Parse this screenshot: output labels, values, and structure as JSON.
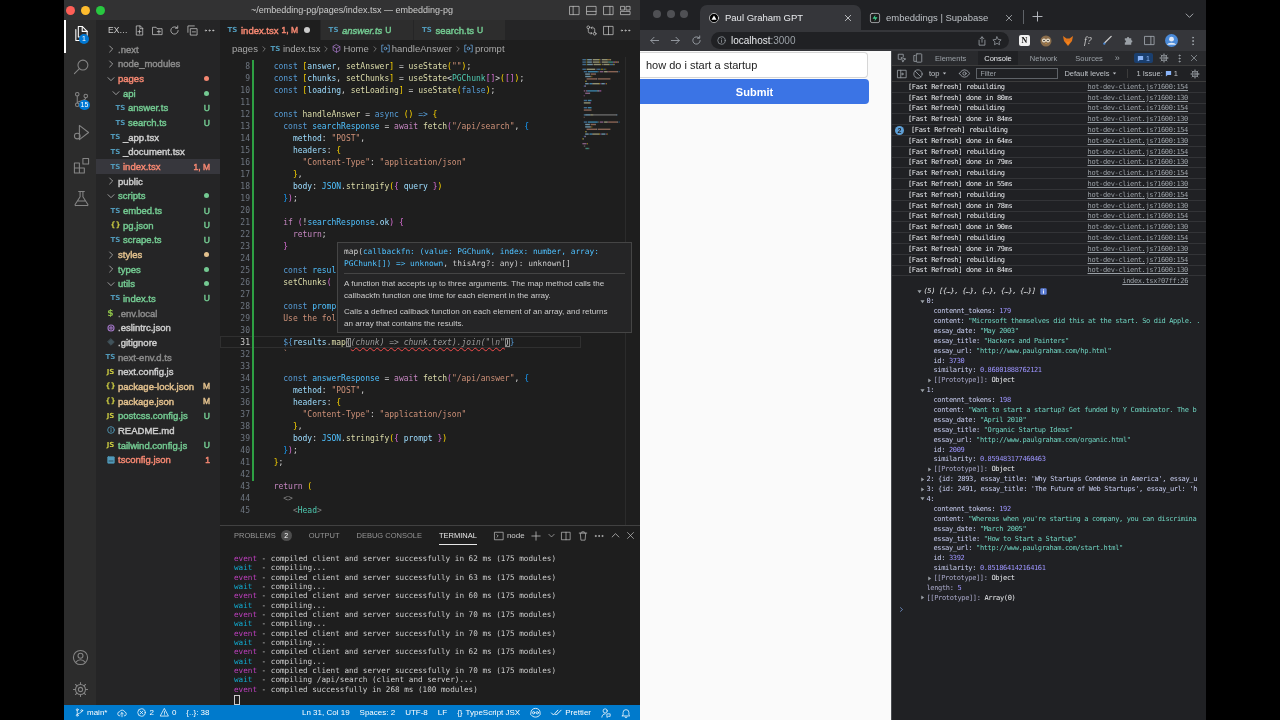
{
  "vscode": {
    "title": "~/embedding-pg/pages/index.tsx — embedding-pg",
    "focused": true,
    "activity_bar": [
      {
        "kind": "explorer",
        "badge": "1",
        "selected": true
      },
      {
        "kind": "search",
        "selected": false
      },
      {
        "kind": "source-control",
        "badge": "15",
        "selected": false
      },
      {
        "kind": "run",
        "selected": false
      },
      {
        "kind": "extensions",
        "selected": false
      },
      {
        "kind": "testing",
        "selected": false
      }
    ],
    "activity_bar_bottom": [
      {
        "kind": "account"
      },
      {
        "kind": "settings"
      }
    ],
    "explorer": {
      "title": "EX…",
      "tree": [
        {
          "name": ".next",
          "kind": "folder",
          "expanded": false,
          "changed": false,
          "color": "#8b8b8b",
          "selected": false
        },
        {
          "name": "node_modules",
          "kind": "folder",
          "expanded": false,
          "changed": false,
          "color": "#8b8b8b",
          "selected": false
        },
        {
          "name": "pages",
          "kind": "folder",
          "expanded": true,
          "changed": true,
          "color": "#f48771",
          "selected": false,
          "children": [
            {
              "name": "api",
              "kind": "folder",
              "expanded": true,
              "changed": true,
              "color": "#73c991",
              "selected": false,
              "children": [
                {
                  "name": "answer.ts",
                  "kind": "ts",
                  "glyph": "TS",
                  "color": "#73c991",
                  "badge": "U",
                  "selected": false
                },
                {
                  "name": "search.ts",
                  "kind": "ts",
                  "glyph": "TS",
                  "color": "#73c991",
                  "badge": "U",
                  "selected": false
                }
              ]
            },
            {
              "name": "_app.tsx",
              "kind": "ts",
              "glyph": "TS",
              "color": "#cccccc",
              "selected": false
            },
            {
              "name": "_document.tsx",
              "kind": "ts",
              "glyph": "TS",
              "color": "#cccccc",
              "selected": false
            },
            {
              "name": "index.tsx",
              "kind": "ts",
              "glyph": "TS",
              "color": "#f48771",
              "badge": "1, M",
              "selected": true
            }
          ]
        },
        {
          "name": "public",
          "kind": "folder",
          "expanded": false,
          "changed": false,
          "color": "#cccccc",
          "selected": false
        },
        {
          "name": "scripts",
          "kind": "folder",
          "expanded": true,
          "changed": true,
          "color": "#73c991",
          "selected": false,
          "children": [
            {
              "name": "embed.ts",
              "kind": "ts",
              "glyph": "TS",
              "color": "#73c991",
              "badge": "U",
              "selected": false
            },
            {
              "name": "pg.json",
              "kind": "json",
              "glyph": "{}",
              "color": "#73c991",
              "badge": "U",
              "selected": false
            },
            {
              "name": "scrape.ts",
              "kind": "ts",
              "glyph": "TS",
              "color": "#73c991",
              "badge": "U",
              "selected": false
            }
          ]
        },
        {
          "name": "styles",
          "kind": "folder",
          "expanded": false,
          "changed": true,
          "color": "#e2c08d",
          "selected": false
        },
        {
          "name": "types",
          "kind": "folder",
          "expanded": false,
          "changed": true,
          "color": "#73c991",
          "selected": false
        },
        {
          "name": "utils",
          "kind": "folder",
          "expanded": true,
          "changed": true,
          "color": "#73c991",
          "selected": false,
          "children": [
            {
              "name": "index.ts",
              "kind": "ts",
              "glyph": "TS",
              "color": "#73c991",
              "badge": "U",
              "selected": false
            }
          ]
        },
        {
          "name": ".env.local",
          "kind": "env",
          "glyph": "$",
          "color": "#8b8b8b",
          "selected": false
        },
        {
          "name": ".eslintrc.json",
          "kind": "eslint",
          "color": "#cccccc",
          "selected": false
        },
        {
          "name": ".gitignore",
          "kind": "git",
          "color": "#cccccc",
          "selected": false
        },
        {
          "name": "next-env.d.ts",
          "kind": "ts",
          "glyph": "TS",
          "color": "#8b8b8b",
          "selected": false
        },
        {
          "name": "next.config.js",
          "kind": "js",
          "glyph": "JS",
          "color": "#cccccc",
          "selected": false
        },
        {
          "name": "package-lock.json",
          "kind": "json",
          "glyph": "{}",
          "color": "#e2c08d",
          "badge": "M",
          "selected": false
        },
        {
          "name": "package.json",
          "kind": "json",
          "glyph": "{}",
          "color": "#e2c08d",
          "badge": "M",
          "selected": false
        },
        {
          "name": "postcss.config.js",
          "kind": "js",
          "glyph": "JS",
          "color": "#73c991",
          "badge": "U",
          "selected": false
        },
        {
          "name": "README.md",
          "kind": "info",
          "color": "#cccccc",
          "selected": false
        },
        {
          "name": "tailwind.config.js",
          "kind": "js",
          "glyph": "JS",
          "color": "#73c991",
          "badge": "U",
          "selected": false
        },
        {
          "name": "tsconfig.json",
          "kind": "tsconfig",
          "color": "#f48771",
          "badge": "1",
          "selected": false
        }
      ]
    },
    "editor": {
      "tabs": [
        {
          "glyph": "TS",
          "label": "index.tsx",
          "badge": "1, M",
          "color": "#f48771",
          "selected": true,
          "preview": false,
          "dirty": true
        },
        {
          "glyph": "TS",
          "label": "answer.ts",
          "badge": "U",
          "color": "#73c991",
          "selected": false,
          "preview": true,
          "dirty": false
        },
        {
          "glyph": "TS",
          "label": "search.ts",
          "badge": "U",
          "color": "#73c991",
          "selected": false,
          "preview": false,
          "dirty": false
        }
      ],
      "breadcrumbs": [
        {
          "kind": "folder",
          "label": "pages"
        },
        {
          "kind": "file",
          "glyph": "TS",
          "label": "index.tsx"
        },
        {
          "kind": "component",
          "label": "Home"
        },
        {
          "kind": "variable",
          "label": "handleAnswer"
        },
        {
          "kind": "variable",
          "label": "prompt"
        }
      ],
      "lines": [
        {
          "number": "8",
          "modified": true,
          "current": false,
          "tokens": [
            {
              "kind": "kw",
              "text": "  const "
            },
            {
              "kind": "b1",
              "text": "["
            },
            {
              "kind": "var",
              "text": "answer"
            },
            {
              "kind": "p",
              "text": ", "
            },
            {
              "kind": "fn",
              "text": "setAnswer"
            },
            {
              "kind": "b1",
              "text": "]"
            },
            {
              "kind": "p",
              "text": " = "
            },
            {
              "kind": "fn",
              "text": "useState"
            },
            {
              "kind": "b1",
              "text": "("
            },
            {
              "kind": "str",
              "text": "\"\""
            },
            {
              "kind": "b1",
              "text": ")"
            },
            {
              "kind": "p",
              "text": ";"
            }
          ]
        },
        {
          "number": "9",
          "modified": true,
          "current": false,
          "tokens": [
            {
              "kind": "kw",
              "text": "  const "
            },
            {
              "kind": "b1",
              "text": "["
            },
            {
              "kind": "var",
              "text": "chunks"
            },
            {
              "kind": "p",
              "text": ", "
            },
            {
              "kind": "fn",
              "text": "setChunks"
            },
            {
              "kind": "b1",
              "text": "]"
            },
            {
              "kind": "p",
              "text": " = "
            },
            {
              "kind": "fn",
              "text": "useState"
            },
            {
              "kind": "p",
              "text": "<"
            },
            {
              "kind": "type",
              "text": "PGChunk"
            },
            {
              "kind": "b2",
              "text": "[]"
            },
            {
              "kind": "p",
              "text": ">"
            },
            {
              "kind": "b1",
              "text": "("
            },
            {
              "kind": "b2",
              "text": "[]"
            },
            {
              "kind": "b1",
              "text": ")"
            },
            {
              "kind": "p",
              "text": ";"
            }
          ]
        },
        {
          "number": "10",
          "modified": true,
          "current": false,
          "tokens": [
            {
              "kind": "kw",
              "text": "  const "
            },
            {
              "kind": "b1",
              "text": "["
            },
            {
              "kind": "var",
              "text": "loading"
            },
            {
              "kind": "p",
              "text": ", "
            },
            {
              "kind": "fn",
              "text": "setLoading"
            },
            {
              "kind": "b1",
              "text": "]"
            },
            {
              "kind": "p",
              "text": " = "
            },
            {
              "kind": "fn",
              "text": "useState"
            },
            {
              "kind": "b1",
              "text": "("
            },
            {
              "kind": "kw",
              "text": "false"
            },
            {
              "kind": "b1",
              "text": ")"
            },
            {
              "kind": "p",
              "text": ";"
            }
          ]
        },
        {
          "number": "11",
          "modified": true,
          "current": false
        },
        {
          "number": "12",
          "modified": true,
          "current": false,
          "tokens": [
            {
              "kind": "kw",
              "text": "  const "
            },
            {
              "kind": "fn",
              "text": "handleAnswer"
            },
            {
              "kind": "p",
              "text": " = "
            },
            {
              "kind": "kw",
              "text": "async "
            },
            {
              "kind": "b1",
              "text": "() "
            },
            {
              "kind": "kw",
              "text": "=> "
            },
            {
              "kind": "b1",
              "text": "{"
            }
          ]
        },
        {
          "number": "13",
          "modified": true,
          "current": false,
          "tokens": [
            {
              "kind": "kw",
              "text": "    const "
            },
            {
              "kind": "cst",
              "text": "searchResponse"
            },
            {
              "kind": "p",
              "text": " = "
            },
            {
              "kind": "ctl",
              "text": "await "
            },
            {
              "kind": "fn",
              "text": "fetch"
            },
            {
              "kind": "b2",
              "text": "("
            },
            {
              "kind": "str",
              "text": "\"/api/search\""
            },
            {
              "kind": "p",
              "text": ", "
            },
            {
              "kind": "b3",
              "text": "{"
            }
          ]
        },
        {
          "number": "14",
          "modified": true,
          "current": false,
          "tokens": [
            {
              "kind": "var",
              "text": "      method"
            },
            {
              "kind": "p",
              "text": ": "
            },
            {
              "kind": "str",
              "text": "\"POST\""
            },
            {
              "kind": "p",
              "text": ","
            }
          ]
        },
        {
          "number": "15",
          "modified": true,
          "current": false,
          "tokens": [
            {
              "kind": "var",
              "text": "      headers"
            },
            {
              "kind": "p",
              "text": ": "
            },
            {
              "kind": "b1",
              "text": "{"
            }
          ]
        },
        {
          "number": "16",
          "modified": true,
          "current": false,
          "tokens": [
            {
              "kind": "str",
              "text": "        \"Content-Type\""
            },
            {
              "kind": "p",
              "text": ": "
            },
            {
              "kind": "str",
              "text": "\"application/json\""
            }
          ]
        },
        {
          "number": "17",
          "modified": true,
          "current": false,
          "tokens": [
            {
              "kind": "b1",
              "text": "      }"
            },
            {
              "kind": "p",
              "text": ","
            }
          ]
        },
        {
          "number": "18",
          "modified": true,
          "current": false,
          "tokens": [
            {
              "kind": "var",
              "text": "      body"
            },
            {
              "kind": "p",
              "text": ": "
            },
            {
              "kind": "cst",
              "text": "JSON"
            },
            {
              "kind": "p",
              "text": "."
            },
            {
              "kind": "fn",
              "text": "stringify"
            },
            {
              "kind": "b1",
              "text": "("
            },
            {
              "kind": "b2",
              "text": "{"
            },
            {
              "kind": "var",
              "text": " query "
            },
            {
              "kind": "b2",
              "text": "}"
            },
            {
              "kind": "b1",
              "text": ")"
            }
          ]
        },
        {
          "number": "19",
          "modified": true,
          "current": false,
          "tokens": [
            {
              "kind": "b3",
              "text": "    }"
            },
            {
              "kind": "b2",
              "text": ")"
            },
            {
              "kind": "p",
              "text": ";"
            }
          ]
        },
        {
          "number": "20",
          "modified": true,
          "current": false
        },
        {
          "number": "21",
          "modified": true,
          "current": false,
          "tokens": [
            {
              "kind": "ctl",
              "text": "    if "
            },
            {
              "kind": "b2",
              "text": "("
            },
            {
              "kind": "p",
              "text": "!"
            },
            {
              "kind": "cst",
              "text": "searchResponse"
            },
            {
              "kind": "p",
              "text": "."
            },
            {
              "kind": "var",
              "text": "ok"
            },
            {
              "kind": "b2",
              "text": ") {"
            }
          ]
        },
        {
          "number": "22",
          "modified": true,
          "current": false,
          "tokens": [
            {
              "kind": "ctl",
              "text": "      return"
            },
            {
              "kind": "p",
              "text": ";"
            }
          ]
        },
        {
          "number": "23",
          "modified": true,
          "current": false,
          "tokens": [
            {
              "kind": "b2",
              "text": "    }"
            }
          ]
        },
        {
          "number": "24",
          "modified": true,
          "current": false
        },
        {
          "number": "25",
          "modified": true,
          "current": false,
          "tokens": [
            {
              "kind": "kw",
              "text": "    const "
            },
            {
              "kind": "cst",
              "text": "resul"
            }
          ]
        },
        {
          "number": "26",
          "modified": true,
          "current": false,
          "tokens": [
            {
              "kind": "fn",
              "text": "    setChunks"
            },
            {
              "kind": "b2",
              "text": "("
            }
          ]
        },
        {
          "number": "27",
          "modified": true,
          "current": false
        },
        {
          "number": "28",
          "modified": true,
          "current": false,
          "tokens": [
            {
              "kind": "kw",
              "text": "    const "
            },
            {
              "kind": "cst",
              "text": "promp"
            }
          ]
        },
        {
          "number": "29",
          "modified": true,
          "current": false,
          "tokens": [
            {
              "kind": "str",
              "text": "    Use the fol"
            }
          ]
        },
        {
          "number": "30",
          "modified": true,
          "current": false
        },
        {
          "number": "31",
          "modified": true,
          "current": true,
          "tokens": [
            {
              "kind": "kw",
              "text": "    ${"
            },
            {
              "kind": "var",
              "text": "results"
            },
            {
              "kind": "p",
              "text": "."
            },
            {
              "kind": "fn",
              "text": "map"
            },
            {
              "kind": "match",
              "text": "("
            },
            {
              "kind": "ghost",
              "text": "(chunk) => chunk.text).join(\"\\n\""
            },
            {
              "kind": "match",
              "text": ")"
            },
            {
              "kind": "kw",
              "text": "}"
            }
          ]
        },
        {
          "number": "32",
          "modified": true,
          "current": false,
          "tokens": [
            {
              "kind": "str",
              "text": "    `"
            }
          ]
        },
        {
          "number": "33",
          "modified": true,
          "current": false
        },
        {
          "number": "34",
          "modified": true,
          "current": false,
          "tokens": [
            {
              "kind": "kw",
              "text": "    const "
            },
            {
              "kind": "cst",
              "text": "answerResponse"
            },
            {
              "kind": "p",
              "text": " = "
            },
            {
              "kind": "ctl",
              "text": "await "
            },
            {
              "kind": "fn",
              "text": "fetch"
            },
            {
              "kind": "b2",
              "text": "("
            },
            {
              "kind": "str",
              "text": "\"/api/answer\""
            },
            {
              "kind": "p",
              "text": ", "
            },
            {
              "kind": "b3",
              "text": "{"
            }
          ]
        },
        {
          "number": "35",
          "modified": true,
          "current": false,
          "tokens": [
            {
              "kind": "var",
              "text": "      method"
            },
            {
              "kind": "p",
              "text": ": "
            },
            {
              "kind": "str",
              "text": "\"POST\""
            },
            {
              "kind": "p",
              "text": ","
            }
          ]
        },
        {
          "number": "36",
          "modified": true,
          "current": false,
          "tokens": [
            {
              "kind": "var",
              "text": "      headers"
            },
            {
              "kind": "p",
              "text": ": "
            },
            {
              "kind": "b1",
              "text": "{"
            }
          ]
        },
        {
          "number": "37",
          "modified": true,
          "current": false,
          "tokens": [
            {
              "kind": "str",
              "text": "        \"Content-Type\""
            },
            {
              "kind": "p",
              "text": ": "
            },
            {
              "kind": "str",
              "text": "\"application/json\""
            }
          ]
        },
        {
          "number": "38",
          "modified": true,
          "current": false,
          "tokens": [
            {
              "kind": "b1",
              "text": "      }"
            },
            {
              "kind": "p",
              "text": ","
            }
          ]
        },
        {
          "number": "39",
          "modified": true,
          "current": false,
          "tokens": [
            {
              "kind": "var",
              "text": "      body"
            },
            {
              "kind": "p",
              "text": ": "
            },
            {
              "kind": "cst",
              "text": "JSON"
            },
            {
              "kind": "p",
              "text": "."
            },
            {
              "kind": "fn",
              "text": "stringify"
            },
            {
              "kind": "b1",
              "text": "("
            },
            {
              "kind": "b2",
              "text": "{"
            },
            {
              "kind": "var",
              "text": " prompt "
            },
            {
              "kind": "b2",
              "text": "}"
            },
            {
              "kind": "b1",
              "text": ")"
            }
          ]
        },
        {
          "number": "40",
          "modified": true,
          "current": false,
          "tokens": [
            {
              "kind": "b3",
              "text": "    }"
            },
            {
              "kind": "b2",
              "text": ")"
            },
            {
              "kind": "p",
              "text": ";"
            }
          ]
        },
        {
          "number": "41",
          "modified": true,
          "current": false,
          "tokens": [
            {
              "kind": "b1",
              "text": "  }"
            },
            {
              "kind": "p",
              "text": ";"
            }
          ]
        },
        {
          "number": "42",
          "modified": true,
          "current": false
        },
        {
          "number": "43",
          "modified": false,
          "current": false,
          "tokens": [
            {
              "kind": "ctl",
              "text": "  return "
            },
            {
              "kind": "b1",
              "text": "("
            }
          ]
        },
        {
          "number": "44",
          "modified": false,
          "current": false,
          "tokens": [
            {
              "kind": "tag",
              "text": "    <>"
            }
          ]
        },
        {
          "number": "45",
          "modified": false,
          "current": false,
          "tokens": [
            {
              "kind": "tag",
              "text": "      <"
            },
            {
              "kind": "type",
              "text": "Head"
            },
            {
              "kind": "tag",
              "text": ">"
            }
          ]
        }
      ],
      "hover": {
        "signature": [
          {
            "kind": "p",
            "text": "map("
          },
          {
            "kind": "var",
            "text": "callbackfn: (value: PGChunk, index: number, array: PGChunk[]) => unknown"
          },
          {
            "kind": "p",
            "text": ", thisArg?: any): unknown[]"
          }
        ],
        "paragraphs": [
          "A function that accepts up to three arguments. The map method calls the callbackfn function one time for each element in the array.",
          "Calls a defined callback function on each element of an array, and returns an array that contains the results."
        ]
      }
    },
    "panel": {
      "tabs": [
        {
          "label": "PROBLEMS",
          "badge": "2",
          "selected": false
        },
        {
          "label": "OUTPUT",
          "selected": false
        },
        {
          "label": "DEBUG CONSOLE",
          "selected": false
        },
        {
          "label": "TERMINAL",
          "selected": true
        }
      ],
      "terminal_name": "node",
      "terminal": [
        {
          "kind": "event",
          "prefix": "event",
          "text": "- compiled client and server successfully in 62 ms (175 modules)"
        },
        {
          "kind": "wait",
          "prefix": "wait",
          "text": "- compiling..."
        },
        {
          "kind": "event",
          "prefix": "event",
          "text": "- compiled client and server successfully in 63 ms (175 modules)"
        },
        {
          "kind": "wait",
          "prefix": "wait",
          "text": "- compiling..."
        },
        {
          "kind": "event",
          "prefix": "event",
          "text": "- compiled client and server successfully in 60 ms (175 modules)"
        },
        {
          "kind": "wait",
          "prefix": "wait",
          "text": "- compiling..."
        },
        {
          "kind": "event",
          "prefix": "event",
          "text": "- compiled client and server successfully in 70 ms (175 modules)"
        },
        {
          "kind": "wait",
          "prefix": "wait",
          "text": "- compiling..."
        },
        {
          "kind": "event",
          "prefix": "event",
          "text": "- compiled client and server successfully in 70 ms (175 modules)"
        },
        {
          "kind": "wait",
          "prefix": "wait",
          "text": "- compiling..."
        },
        {
          "kind": "event",
          "prefix": "event",
          "text": "- compiled client and server successfully in 62 ms (175 modules)"
        },
        {
          "kind": "wait",
          "prefix": "wait",
          "text": "- compiling..."
        },
        {
          "kind": "event",
          "prefix": "event",
          "text": "- compiled client and server successfully in 70 ms (175 modules)"
        },
        {
          "kind": "wait",
          "prefix": "wait",
          "text": "- compiling /api/search (client and server)..."
        },
        {
          "kind": "event",
          "prefix": "event",
          "text": "- compiled successfully in 268 ms (100 modules)"
        }
      ]
    },
    "status_bar": {
      "left": [
        {
          "kind": "branch",
          "text": "main*"
        },
        {
          "kind": "publish"
        },
        {
          "kind": "problems",
          "errors": "2",
          "warnings": "0"
        },
        {
          "kind": "plain",
          "text": "{..}: 38"
        }
      ],
      "right": [
        {
          "kind": "plain",
          "text": "Ln 31, Col 19"
        },
        {
          "kind": "plain",
          "text": "Spaces: 2"
        },
        {
          "kind": "plain",
          "text": "UTF-8"
        },
        {
          "kind": "plain",
          "text": "LF"
        },
        {
          "kind": "language",
          "glyph": "{}",
          "text": "TypeScript JSX"
        },
        {
          "kind": "copilot"
        },
        {
          "kind": "prettier",
          "text": "Prettier"
        },
        {
          "kind": "feedback"
        },
        {
          "kind": "notifications"
        }
      ]
    }
  },
  "browser": {
    "focused": false,
    "tabs": [
      {
        "kind": "triangle",
        "title": "Paul Graham GPT",
        "selected": true
      },
      {
        "kind": "lightning",
        "title": "embeddings | Supabase",
        "selected": false
      }
    ],
    "address": {
      "host": "localhost",
      "port": ":3000"
    },
    "extensions": [
      {
        "kind": "letter",
        "glyph": "N"
      },
      {
        "kind": "owl"
      },
      {
        "kind": "fox"
      },
      {
        "kind": "italic-letter",
        "glyph": "f?"
      },
      {
        "kind": "pen"
      }
    ],
    "page": {
      "query": "how do i start a startup",
      "button": "Submit"
    },
    "devtools": {
      "tabs": [
        {
          "label": "Elements",
          "selected": false
        },
        {
          "label": "Console",
          "selected": true
        },
        {
          "label": "Network",
          "selected": false
        },
        {
          "label": "Sources",
          "selected": false
        }
      ],
      "more": "»",
      "messages": "1",
      "context": "top",
      "filter_placeholder": "Filter",
      "levels": "Default levels",
      "issues_label": "1 Issue:",
      "issues_count": "1",
      "logs": [
        {
          "text": "[Fast Refresh] rebuilding",
          "source": "hot-dev-client.js?1600:154"
        },
        {
          "text": "[Fast Refresh] done in 80ms",
          "source": "hot-dev-client.js?1600:130"
        },
        {
          "text": "[Fast Refresh] rebuilding",
          "source": "hot-dev-client.js?1600:154"
        },
        {
          "text": "[Fast Refresh] done in 84ms",
          "source": "hot-dev-client.js?1600:130"
        },
        {
          "text": "[Fast Refresh] rebuilding",
          "source": "hot-dev-client.js?1600:154",
          "repeat": "2"
        },
        {
          "text": "[Fast Refresh] done in 64ms",
          "source": "hot-dev-client.js?1600:130"
        },
        {
          "text": "[Fast Refresh] rebuilding",
          "source": "hot-dev-client.js?1600:154"
        },
        {
          "text": "[Fast Refresh] done in 79ms",
          "source": "hot-dev-client.js?1600:130"
        },
        {
          "text": "[Fast Refresh] rebuilding",
          "source": "hot-dev-client.js?1600:154"
        },
        {
          "text": "[Fast Refresh] done in 55ms",
          "source": "hot-dev-client.js?1600:130"
        },
        {
          "text": "[Fast Refresh] rebuilding",
          "source": "hot-dev-client.js?1600:154"
        },
        {
          "text": "[Fast Refresh] done in 78ms",
          "source": "hot-dev-client.js?1600:130"
        },
        {
          "text": "[Fast Refresh] rebuilding",
          "source": "hot-dev-client.js?1600:154"
        },
        {
          "text": "[Fast Refresh] done in 90ms",
          "source": "hot-dev-client.js?1600:130"
        },
        {
          "text": "[Fast Refresh] rebuilding",
          "source": "hot-dev-client.js?1600:154"
        },
        {
          "text": "[Fast Refresh] done in 79ms",
          "source": "hot-dev-client.js?1600:130"
        },
        {
          "text": "[Fast Refresh] rebuilding",
          "source": "hot-dev-client.js?1600:154"
        },
        {
          "text": "[Fast Refresh] done in 84ms",
          "source": "hot-dev-client.js?1600:130"
        }
      ],
      "object": {
        "source": "index.tsx?07ff:26",
        "summary": "(5) [{…}, {…}, {…}, {…}, {…}]",
        "expanded": true,
        "children": [
          {
            "key": "0:",
            "expanded": true,
            "children": [
              {
                "key": "contennt_tokens:",
                "value": "179",
                "kind": "number"
              },
              {
                "key": "content:",
                "value": "\"Microsoft themselves did this at the start. So did Apple. .",
                "kind": "string"
              },
              {
                "key": "essay_date:",
                "value": "\"May 2003\"",
                "kind": "string"
              },
              {
                "key": "essay_title:",
                "value": "\"Hackers and Painters\"",
                "kind": "string"
              },
              {
                "key": "essay_url:",
                "value": "\"http://www.paulgraham.com/hp.html\"",
                "kind": "string"
              },
              {
                "key": "id:",
                "value": "3730",
                "kind": "number"
              },
              {
                "key": "similarity:",
                "value": "0.86801888762121",
                "kind": "number"
              },
              {
                "key": "[[Prototype]]:",
                "value": "Object",
                "kind": "proto",
                "expanded": false
              }
            ]
          },
          {
            "key": "1:",
            "expanded": true,
            "children": [
              {
                "key": "contennt_tokens:",
                "value": "198",
                "kind": "number"
              },
              {
                "key": "content:",
                "value": "\"Want to start a startup? Get funded by Y Combinator. The b",
                "kind": "string"
              },
              {
                "key": "essay_date:",
                "value": "\"April 2010\"",
                "kind": "string"
              },
              {
                "key": "essay_title:",
                "value": "\"Organic Startup Ideas\"",
                "kind": "string"
              },
              {
                "key": "essay_url:",
                "value": "\"http://www.paulgraham.com/organic.html\"",
                "kind": "string"
              },
              {
                "key": "id:",
                "value": "2009",
                "kind": "number"
              },
              {
                "key": "similarity:",
                "value": "0.859483177460463",
                "kind": "number"
              },
              {
                "key": "[[Prototype]]:",
                "value": "Object",
                "kind": "proto",
                "expanded": false
              }
            ]
          },
          {
            "key": "2:",
            "expanded": false,
            "preview": "{id: 2893, essay_title: 'Why Startups Condense in America', essay_u"
          },
          {
            "key": "3:",
            "expanded": false,
            "preview": "{id: 2491, essay_title: 'The Future of Web Startups', essay_url: 'h"
          },
          {
            "key": "4:",
            "expanded": true,
            "children": [
              {
                "key": "contennt_tokens:",
                "value": "192",
                "kind": "number"
              },
              {
                "key": "content:",
                "value": "\"Whereas when you're starting a company, you can discrimina",
                "kind": "string"
              },
              {
                "key": "essay_date:",
                "value": "\"March 2005\"",
                "kind": "string"
              },
              {
                "key": "essay_title:",
                "value": "\"How to Start a Startup\"",
                "kind": "string"
              },
              {
                "key": "essay_url:",
                "value": "\"http://www.paulgraham.com/start.html\"",
                "kind": "string"
              },
              {
                "key": "id:",
                "value": "3392",
                "kind": "number"
              },
              {
                "key": "similarity:",
                "value": "0.851864142164161",
                "kind": "number"
              },
              {
                "key": "[[Prototype]]:",
                "value": "Object",
                "kind": "proto",
                "expanded": false
              }
            ]
          },
          {
            "key": "length:",
            "value": "5",
            "kind": "meta"
          },
          {
            "key": "[[Prototype]]:",
            "value": "Array(0)",
            "kind": "proto",
            "expanded": false
          }
        ]
      }
    }
  }
}
